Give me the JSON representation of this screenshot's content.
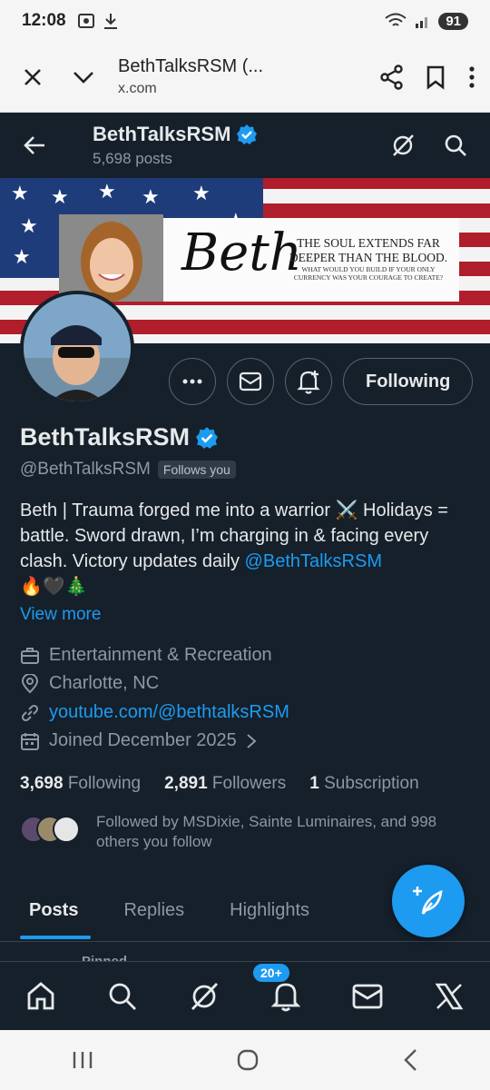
{
  "status_bar": {
    "time": "12:08",
    "battery": "91"
  },
  "browser": {
    "title": "BethTalksRSM (...",
    "url": "x.com"
  },
  "header": {
    "name": "BethTalksRSM",
    "post_count": "5,698 posts"
  },
  "banner": {
    "script_name": "Beth",
    "tagline": "THE SOUL EXTENDS FAR DEEPER THAN THE BLOOD.",
    "subtagline": "WHAT WOULD YOU BUILD IF YOUR ONLY CURRENCY WAS YOUR COURAGE TO CREATE?"
  },
  "actions": {
    "following_label": "Following"
  },
  "profile": {
    "display_name": "BethTalksRSM",
    "handle": "@BethTalksRSM",
    "follows_you": "Follows you",
    "bio_text": "Beth | Trauma forged me into a warrior ⚔️ Holidays = battle. Sword drawn, I’m charging in & facing every clash. Victory updates daily ",
    "bio_mention": "@BethTalksRSM",
    "bio_emojis": "🔥🖤🎄",
    "view_more": "View more",
    "category": "Entertainment & Recreation",
    "location": "Charlotte, NC",
    "website": "youtube.com/@bethtalksRSM",
    "joined": "Joined December 2025"
  },
  "counts": {
    "following_num": "3,698",
    "following_label": "Following",
    "followers_num": "2,891",
    "followers_label": "Followers",
    "subscription_num": "1",
    "subscription_label": "Subscription"
  },
  "followed_by": "Followed by MSDixie, Sainte Luminaires, and 998 others you follow",
  "tabs": {
    "posts": "Posts",
    "replies": "Replies",
    "highlights": "Highlights"
  },
  "pinned": "Pinned",
  "bottom_nav": {
    "notification_badge": "20+"
  },
  "colors": {
    "background": "#15202b",
    "accent": "#1d9bf0",
    "muted": "#8b98a5"
  }
}
